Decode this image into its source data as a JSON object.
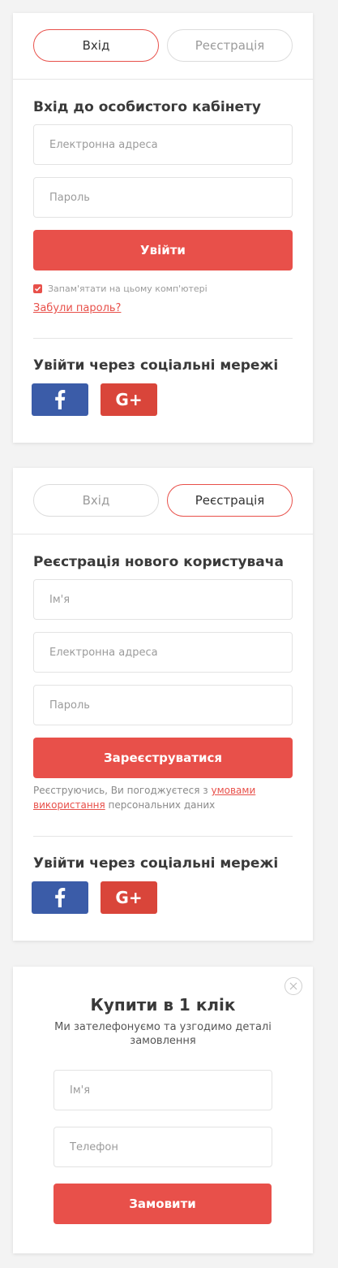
{
  "login": {
    "tabs": {
      "login": "Вхід",
      "register": "Реєстрація"
    },
    "heading": "Вхід до особистого кабінету",
    "email_placeholder": "Електронна адреса",
    "password_placeholder": "Пароль",
    "submit_label": "Увійти",
    "remember_label": "Запам'ятати на цьому комп'ютері",
    "remember_checked": true,
    "forgot_label": "Забули пароль?",
    "social_heading": "Увійти через соціальні мережі"
  },
  "register": {
    "tabs": {
      "login": "Вхід",
      "register": "Реєстрація"
    },
    "heading": "Реєстрація нового користувача",
    "name_placeholder": "Ім'я",
    "email_placeholder": "Електронна адреса",
    "password_placeholder": "Пароль",
    "submit_label": "Зареєструватися",
    "terms_prefix": "Реєструючись, Ви погоджуєтеся з ",
    "terms_link": "умовами використання",
    "terms_suffix": " персональних даних",
    "social_heading": "Увійти через соціальні мережі"
  },
  "social": {
    "facebook_icon": "facebook-icon",
    "google_icon": "google-plus-icon",
    "google_label": "G+"
  },
  "oneclick": {
    "title": "Купити в 1 клік",
    "subtitle": "Ми зателефонуємо та узгодимо деталі замовлення",
    "name_placeholder": "Ім'я",
    "phone_placeholder": "Телефон",
    "submit_label": "Замовити"
  },
  "colors": {
    "accent": "#e8504a",
    "facebook": "#3b5ca8",
    "google": "#d9453a"
  }
}
